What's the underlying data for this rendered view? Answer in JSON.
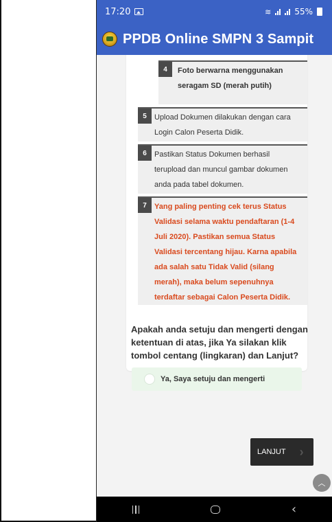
{
  "status_bar": {
    "time": "17:20",
    "battery": "55%"
  },
  "app_bar": {
    "title": "PPDB Online SMPN 3 Sampit"
  },
  "steps": [
    {
      "number": "4",
      "text": "Foto berwarna menggunakan seragam SD (merah putih)"
    },
    {
      "number": "5",
      "text": "Upload Dokumen dilakukan dengan cara Login Calon Peserta Didik."
    },
    {
      "number": "6",
      "text": "Pastikan Status Dokumen berhasil terupload dan muncul gambar dokumen anda pada tabel dokumen."
    },
    {
      "number": "7",
      "text": "Yang paling penting cek terus Status Validasi selama waktu pendaftaran (1-4 Juli 2020). Pastikan semua Status Validasi tercentang hijau. Karna apabila ada salah satu Tidak Valid (silang merah), maka belum sepenuhnya terdaftar sebagai Calon Peserta Didik."
    }
  ],
  "question": "Apakah anda setuju dan mengerti dengan ketentuan di atas, jika Ya silakan klik tombol centang (lingkaran) dan Lanjut?",
  "agree_label": "Ya, Saya setuju dan mengerti",
  "lanjut_label": "LANJUT",
  "colors": {
    "app_bar": "#3b62c5",
    "warning_text": "#d94a1e",
    "agree_bg": "#eaf6ea"
  }
}
